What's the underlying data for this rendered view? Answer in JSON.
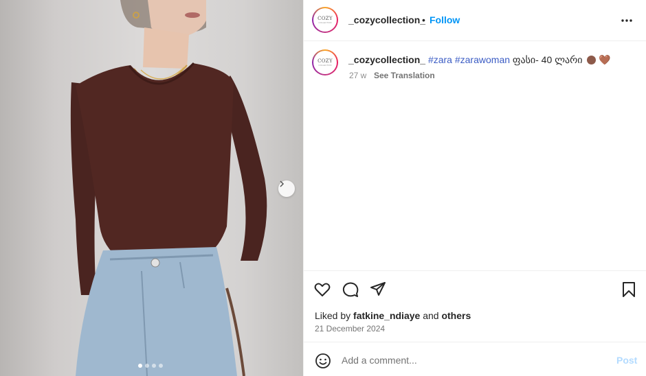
{
  "post": {
    "username": "_cozycollection_",
    "follow_label": "Follow",
    "bullet": "•",
    "avatar_logo_text": "COZY",
    "avatar_logo_sub": "COLLECTION"
  },
  "caption": {
    "username": "_cozycollection_",
    "hashtags": [
      "#zara",
      "#zarawoman"
    ],
    "text": "ფასი- 40 ლარი",
    "emoji_heart": "🤎",
    "age": "27 w",
    "see_translation": "See Translation"
  },
  "engagement": {
    "liked_prefix": "Liked by",
    "liked_user": "fatkine_ndiaye",
    "liked_and": "and",
    "liked_others": "others",
    "date": "21 December 2024"
  },
  "comment_box": {
    "placeholder": "Add a comment...",
    "post_label": "Post"
  },
  "carousel": {
    "total_slides": 4,
    "active_slide": 1
  },
  "icons": {
    "more": "more-options-icon",
    "next": "chevron-right-icon",
    "like": "heart-icon",
    "comment": "comment-icon",
    "share": "share-icon",
    "save": "bookmark-icon",
    "emoji": "smiley-icon"
  },
  "colors": {
    "follow": "#0095f6",
    "hashtag": "#3b5cc4",
    "post_disabled": "#b3dbff",
    "top_color": "#4a2420",
    "jeans": "#9fb8cf"
  }
}
